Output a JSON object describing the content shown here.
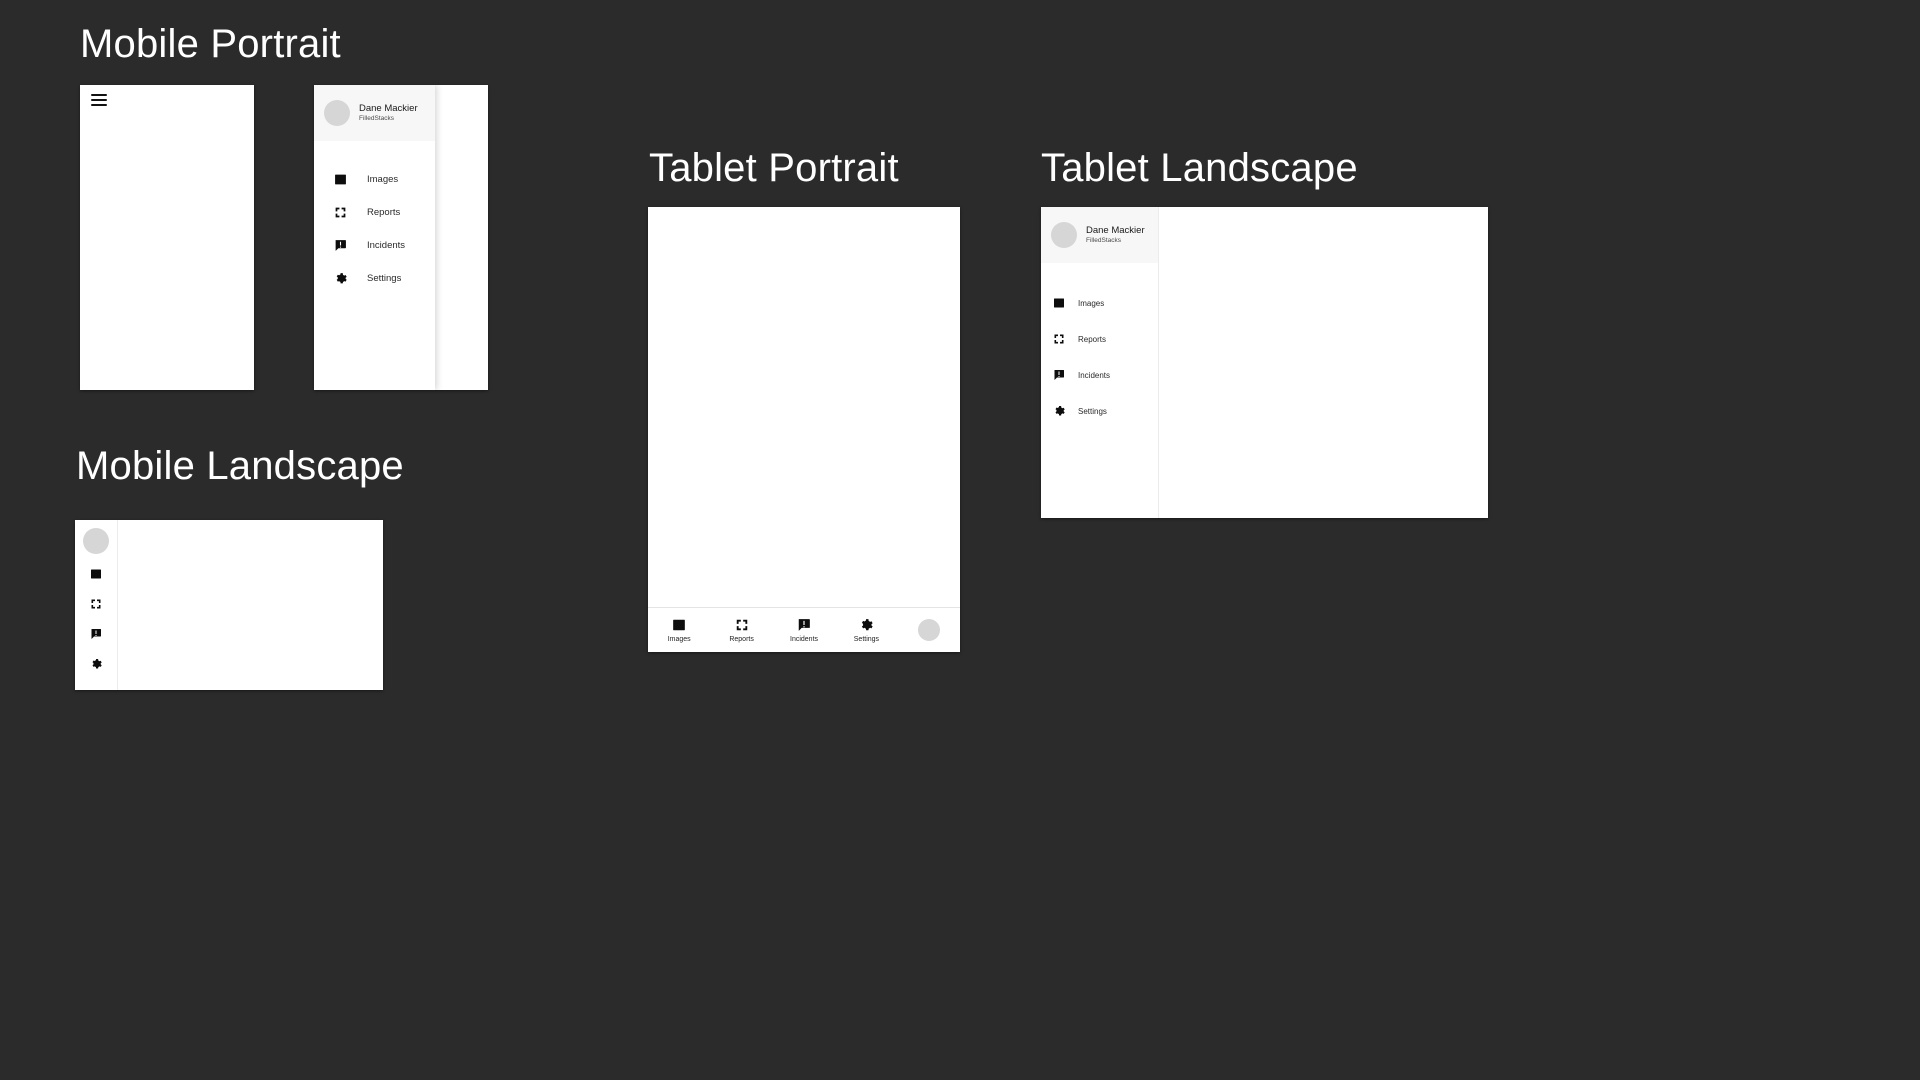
{
  "background_color": "#2b2b2b",
  "sections": {
    "mobile_portrait": {
      "title": "Mobile Portrait"
    },
    "mobile_landscape": {
      "title": "Mobile Landscape"
    },
    "tablet_portrait": {
      "title": "Tablet Portrait"
    },
    "tablet_landscape": {
      "title": "Tablet Landscape"
    }
  },
  "profile": {
    "name": "Dane Mackier",
    "subtitle": "FilledStacks",
    "avatar_color": "#d6d6d6"
  },
  "nav_items": [
    {
      "label": "Images",
      "icon": "image-icon"
    },
    {
      "label": "Reports",
      "icon": "reports-icon"
    },
    {
      "label": "Incidents",
      "icon": "incidents-icon"
    },
    {
      "label": "Settings",
      "icon": "settings-icon"
    }
  ],
  "menu_button": {
    "icon": "hamburger-icon"
  },
  "colors": {
    "surface": "#ffffff",
    "header_surface": "#f7f7f7",
    "icon": "#0d0d0d",
    "label": "#2a2a2a",
    "divider": "#ececec"
  }
}
